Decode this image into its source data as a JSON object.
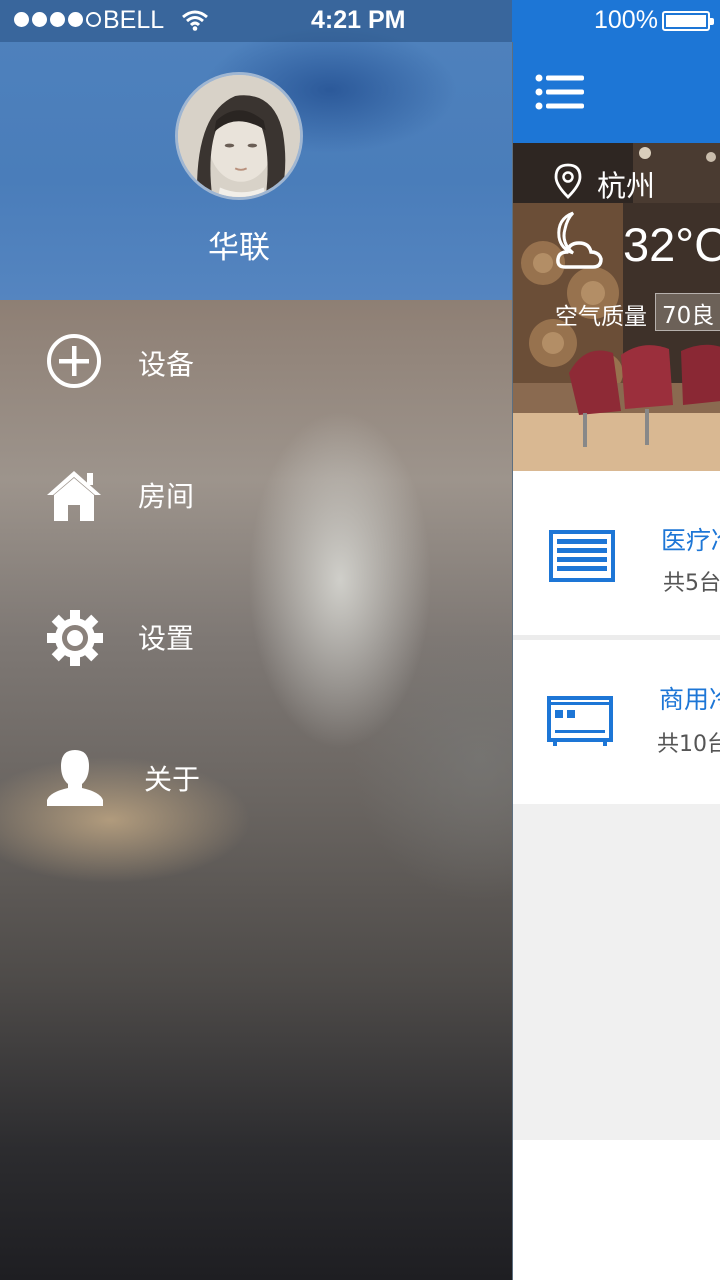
{
  "status_bar": {
    "carrier": "BELL",
    "time": "4:21 PM",
    "battery": "100%"
  },
  "drawer": {
    "username": "华联",
    "menu": [
      {
        "label": "设备",
        "icon": "add-circle-icon"
      },
      {
        "label": "房间",
        "icon": "home-icon"
      },
      {
        "label": "设置",
        "icon": "gear-icon"
      },
      {
        "label": "关于",
        "icon": "person-icon"
      }
    ]
  },
  "main": {
    "weather": {
      "city": "杭州",
      "temperature": "32°C",
      "air_quality_label": "空气质量",
      "air_quality_value": "70良"
    },
    "cards": [
      {
        "title": "医疗冷",
        "subtitle": "共5台",
        "icon": "medical-device-icon"
      },
      {
        "title": "商用冷",
        "subtitle": "共10台",
        "icon": "commercial-device-icon"
      }
    ]
  },
  "colors": {
    "accent": "#1d76d6",
    "drawer_header": "#4a7dba"
  }
}
